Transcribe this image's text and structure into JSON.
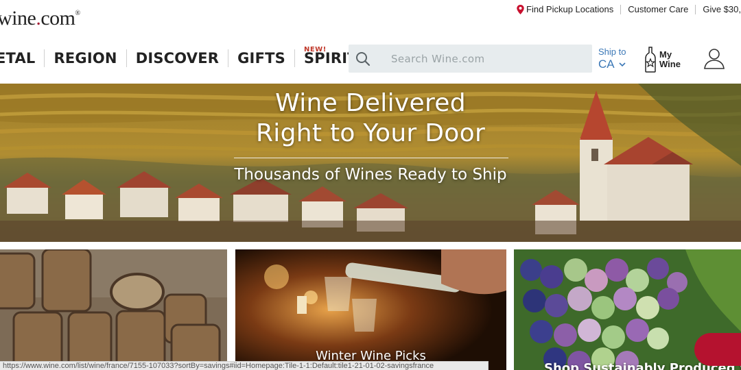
{
  "logo": {
    "text": "wine",
    "dot": ".",
    "suffix": "com",
    "reg": "®"
  },
  "utility": {
    "pickup": "Find Pickup Locations",
    "care": "Customer Care",
    "give": "Give $30,"
  },
  "nav": {
    "items": [
      {
        "label": "ETAL",
        "badge": ""
      },
      {
        "label": "REGION",
        "badge": ""
      },
      {
        "label": "DISCOVER",
        "badge": ""
      },
      {
        "label": "GIFTS",
        "badge": ""
      },
      {
        "label": "SPIRITS",
        "badge": "NEW!"
      }
    ]
  },
  "search": {
    "placeholder": "Search Wine.com",
    "value": ""
  },
  "ship": {
    "line1": "Ship to",
    "state": "CA"
  },
  "mywine": {
    "line1": "My",
    "line2": "Wine"
  },
  "hero": {
    "title1": "Wine Delivered",
    "title2": "Right to Your Door",
    "subtitle": "Thousands of Wines Ready to Ship"
  },
  "tiles": [
    {
      "caption": ""
    },
    {
      "caption": "Winter Wine Picks"
    },
    {
      "caption": "Shop Sustainably Produced Wi"
    }
  ],
  "status_url": "https://www.wine.com/list/wine/france/7155-107033?sortBy=savings#iid=Homepage:Tile-1-1:Default:tile1-21-01-02-savingsfrance",
  "colors": {
    "brand": "#a51e36",
    "link": "#3a77b6",
    "search_bg": "#e7ecee"
  },
  "icons": [
    "location-pin-icon",
    "search-icon",
    "chevron-down-icon",
    "wine-bottle-star-icon",
    "user-icon"
  ]
}
